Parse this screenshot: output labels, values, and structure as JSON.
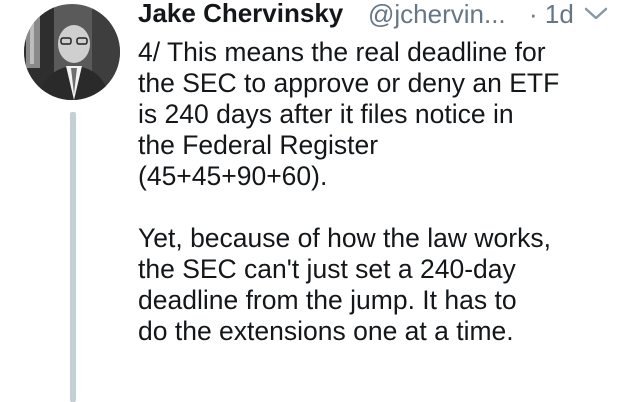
{
  "tweet": {
    "author_name": "Jake Chervinsky",
    "author_handle": "@jchervin...",
    "timestamp": "· 1d",
    "more_icon": "chevron-down-icon",
    "avatar_icon": "avatar",
    "paragraphs": [
      {
        "lines": [
          "4/ This means the real deadline for",
          "the SEC to approve or deny an ETF",
          "is 240 days after it files notice in",
          "the Federal Register",
          "(45+45+90+60)."
        ]
      },
      {
        "lines": [
          "Yet, because of how the law works,",
          "the SEC can't just set a 240-day",
          "deadline from the jump. It has to",
          "do the extensions one at a time."
        ]
      }
    ]
  },
  "colors": {
    "text": "#14171a",
    "secondary": "#657786",
    "thread_line": "#c4cfd6",
    "background": "#ffffff"
  }
}
